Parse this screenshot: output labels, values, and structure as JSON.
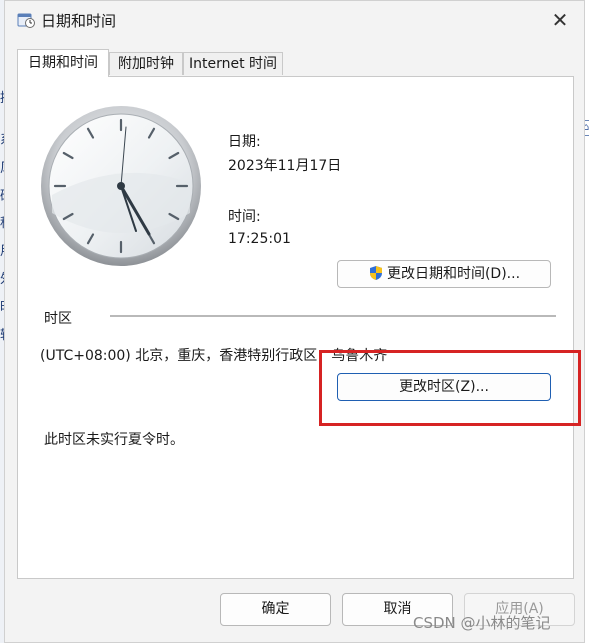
{
  "window": {
    "title": "日期和时间",
    "close_glyph": "✕"
  },
  "tabs": [
    {
      "label": "日期和时间",
      "active": true
    },
    {
      "label": "附加时钟",
      "active": false
    },
    {
      "label": "Internet 时间",
      "active": false
    }
  ],
  "date_time": {
    "date_label": "日期:",
    "date_value": "2023年11月17日",
    "time_label": "时间:",
    "time_value": "17:25:01",
    "change_button": "更改日期和时间(D)..."
  },
  "timezone": {
    "section_label": "时区",
    "value": "(UTC+08:00) 北京，重庆，香港特别行政区，乌鲁木齐",
    "change_button": "更改时区(Z)...",
    "dst_note": "此时区未实行夏令时。"
  },
  "footer": {
    "ok": "确定",
    "cancel": "取消",
    "apply": "应用(A)"
  },
  "watermark": "CSDN @小林的笔记",
  "background_glyphs": [
    "控",
    "系",
    "风",
    "硬",
    "程",
    "用",
    "外",
    "时",
    "轻"
  ],
  "icons": {
    "app": "calendar-clock-icon",
    "shield": "uac-shield-icon",
    "clock": "analog-clock-icon"
  },
  "colors": {
    "highlight": "#d62323",
    "primary_border": "#1f5fb2"
  }
}
